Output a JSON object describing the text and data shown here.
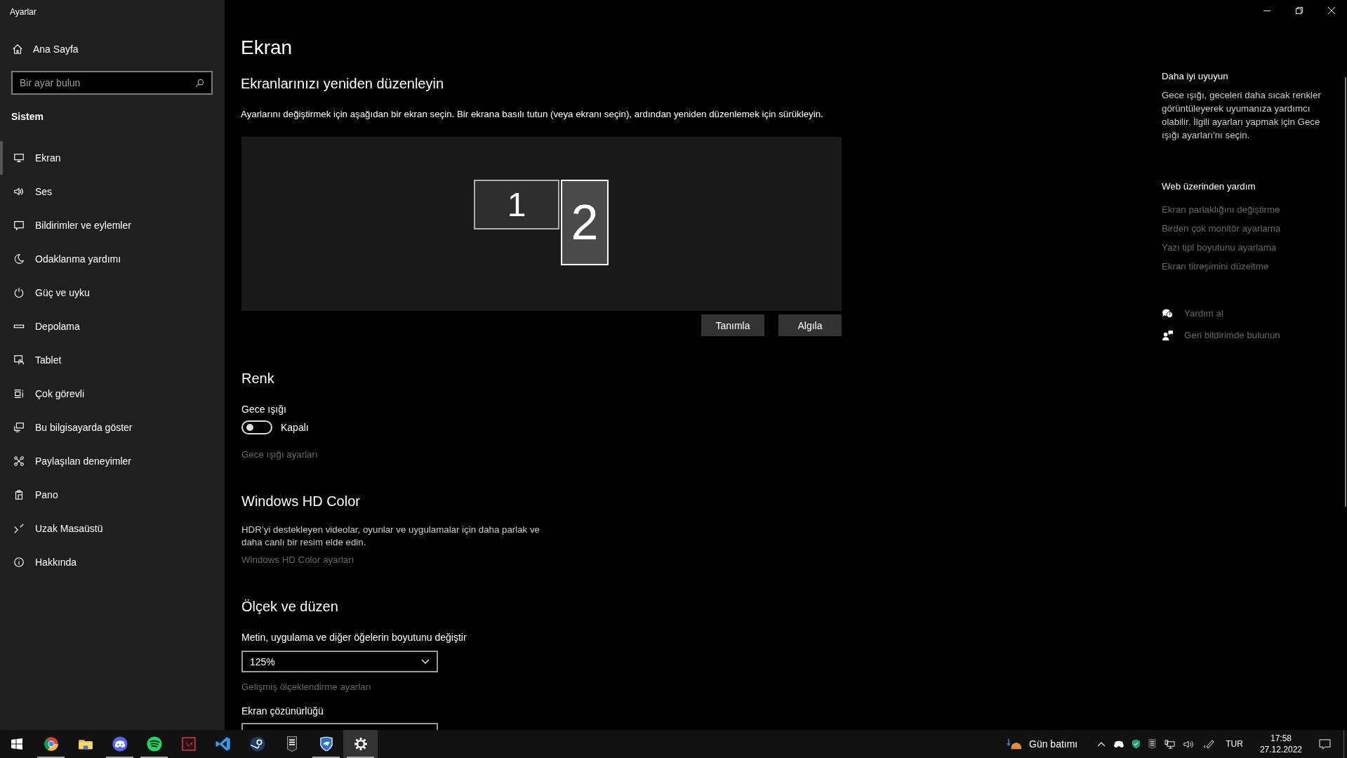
{
  "window": {
    "title": "Ayarlar"
  },
  "sidebar": {
    "home": "Ana Sayfa",
    "search": {
      "placeholder": "Bir ayar bulun"
    },
    "section": "Sistem",
    "items": [
      {
        "label": "Ekran",
        "selected": true
      },
      {
        "label": "Ses",
        "selected": false
      },
      {
        "label": "Bildirimler ve eylemler",
        "selected": false
      },
      {
        "label": "Odaklanma yardımı",
        "selected": false
      },
      {
        "label": "Güç ve uyku",
        "selected": false
      },
      {
        "label": "Depolama",
        "selected": false
      },
      {
        "label": "Tablet",
        "selected": false
      },
      {
        "label": "Çok görevli",
        "selected": false
      },
      {
        "label": "Bu bilgisayarda göster",
        "selected": false
      },
      {
        "label": "Paylaşılan deneyimler",
        "selected": false
      },
      {
        "label": "Pano",
        "selected": false
      },
      {
        "label": "Uzak Masaüstü",
        "selected": false
      },
      {
        "label": "Hakkında",
        "selected": false
      }
    ]
  },
  "main": {
    "title": "Ekran",
    "arrange": {
      "heading": "Ekranlarınızı yeniden düzenleyin",
      "description": "Ayarlarını değiştirmek için aşağıdan bir ekran seçin. Bir ekrana basılı tutun (veya ekranı seçin), ardından yeniden düzenlemek için sürükleyin.",
      "displays": [
        {
          "label": "1",
          "selected": false
        },
        {
          "label": "2",
          "selected": true
        }
      ],
      "buttons": [
        "Tanımla",
        "Algıla"
      ]
    },
    "color": {
      "heading": "Renk",
      "night_light": {
        "label": "Gece ışığı",
        "on": false,
        "state": "Kapalı"
      },
      "link": "Gece ışığı ayarları"
    },
    "hd_color": {
      "heading": "Windows HD Color",
      "description": "HDR’yi destekleyen videolar, oyunlar ve uygulamalar için daha parlak ve daha canlı bir resim elde edin.",
      "link": "Windows HD Color ayarları"
    },
    "scale": {
      "heading": "Ölçek ve düzen",
      "size_label": "Metin, uygulama ve diğer öğelerin boyutunu değiştir",
      "size_value": "125%",
      "link": "Gelişmiş ölçeklendirme ayarları",
      "resolution_label": "Ekran çözünürlüğü"
    }
  },
  "right_panel": {
    "sleep_heading": "Daha iyi uyuyun",
    "sleep_text": "Gece ışığı, geceleri daha sıcak renkler görüntüleyerek uyumanıza yardımcı olabilir. İlgili ayarları yapmak için Gece ışığı ayarları'nı seçin.",
    "web_heading": "Web üzerinden yardım",
    "web_links": [
      "Ekran parlaklığını değiştirme",
      "Birden çok monitör ayarlama",
      "Yazı tipi boyutunu ayarlama",
      "Ekran titreşimini düzeltme"
    ],
    "actions": [
      "Yardım al",
      "Geri bildirimde bulunun"
    ]
  },
  "taskbar": {
    "apps": [
      {
        "running": true,
        "selected": false
      },
      {
        "running": false,
        "selected": false
      },
      {
        "running": true,
        "selected": false
      },
      {
        "running": true,
        "selected": false
      },
      {
        "running": false,
        "selected": false
      },
      {
        "running": false,
        "selected": false
      },
      {
        "running": false,
        "selected": false
      },
      {
        "running": false,
        "selected": false
      },
      {
        "running": true,
        "selected": false
      },
      {
        "running": true,
        "selected": true
      }
    ],
    "weather": "Gün batımı",
    "language": "TUR",
    "time": "17:58",
    "date": "27.12.2022"
  }
}
